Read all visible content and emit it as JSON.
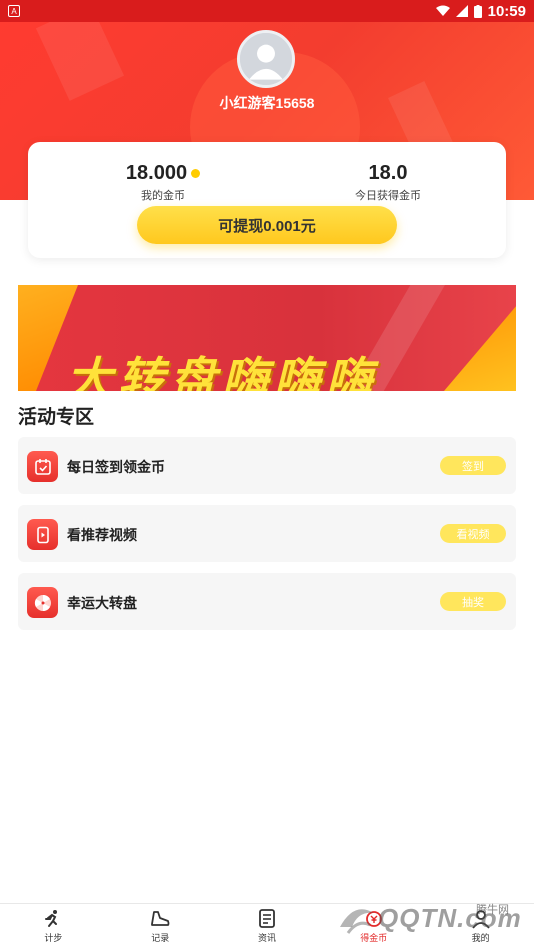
{
  "status_bar": {
    "time": "10:59",
    "left_badge": "A"
  },
  "profile": {
    "username": "小红游客15658"
  },
  "stats": {
    "coins": {
      "value": "18.000",
      "label": "我的金币"
    },
    "today": {
      "value": "18.0",
      "label": "今日获得金币"
    }
  },
  "withdraw_button": "可提现0.001元",
  "banner": {
    "text": "大转盘嗨嗨嗨"
  },
  "section_title": "活动专区",
  "activities": [
    {
      "title": "每日签到领金币",
      "action": "签到",
      "icon": "calendar-icon"
    },
    {
      "title": "看推荐视频",
      "action": "看视频",
      "icon": "phone-video-icon"
    },
    {
      "title": "幸运大转盘",
      "action": "抽奖",
      "icon": "wheel-icon"
    }
  ],
  "tabbar": [
    {
      "label": "计步",
      "icon": "running-icon"
    },
    {
      "label": "记录",
      "icon": "shoe-icon"
    },
    {
      "label": "资讯",
      "icon": "news-icon"
    },
    {
      "label": "得金币",
      "icon": "coin-icon",
      "active": true
    },
    {
      "label": "我的",
      "icon": "profile-icon"
    }
  ],
  "watermark": {
    "text": "QQTN.com",
    "small": "腾牛网"
  },
  "colors": {
    "primary_red": "#f33d2f",
    "gold": "#ffc81e",
    "pill_yellow": "#ffe65c"
  }
}
